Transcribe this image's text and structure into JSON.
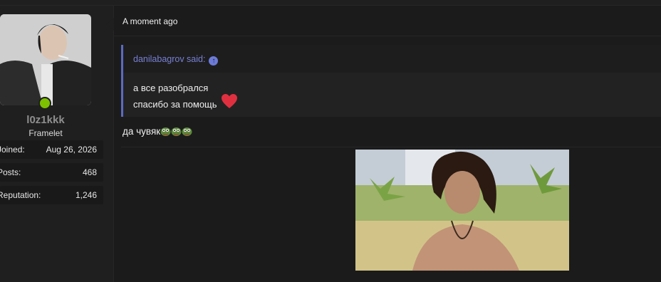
{
  "user": {
    "username": "l0z1kkk",
    "title": "Framelet",
    "online": true,
    "stats": [
      {
        "label": "Joined:",
        "value": "Aug 26, 2026"
      },
      {
        "label": "Posts:",
        "value": "468"
      },
      {
        "label": "Reputation:",
        "value": "1,246"
      }
    ]
  },
  "post": {
    "timestamp": "A moment ago",
    "quote": {
      "author_line": "danilabagrov said:",
      "lines": [
        "а все разобрался",
        "спасибо за помощь"
      ]
    },
    "message": "да чувяк"
  },
  "colors": {
    "quote_accent": "#5c6bc0",
    "online_dot": "#7cc000",
    "heart": "#e03040"
  }
}
